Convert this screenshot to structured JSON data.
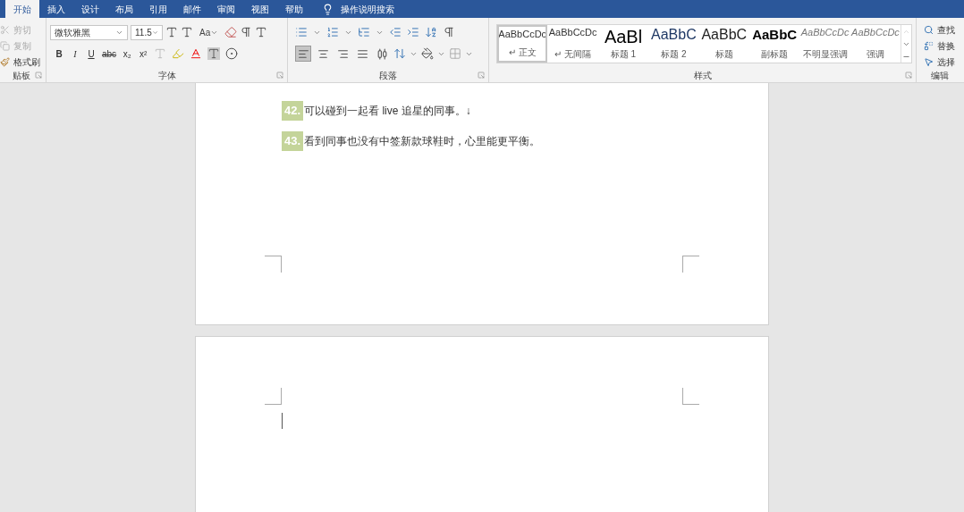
{
  "tabs": [
    {
      "label": "开始",
      "selected": true
    },
    {
      "label": "插入",
      "selected": false
    },
    {
      "label": "设计",
      "selected": false
    },
    {
      "label": "布局",
      "selected": false
    },
    {
      "label": "引用",
      "selected": false
    },
    {
      "label": "邮件",
      "selected": false
    },
    {
      "label": "审阅",
      "selected": false
    },
    {
      "label": "视图",
      "selected": false
    },
    {
      "label": "帮助",
      "selected": false
    }
  ],
  "tell_me": "操作说明搜索",
  "clipboard": {
    "group_label": "贴板",
    "items": [
      {
        "kind": "cut",
        "label": "剪切",
        "disabled": true
      },
      {
        "kind": "copy",
        "label": "复制",
        "disabled": true
      },
      {
        "kind": "painter",
        "label": "格式刷",
        "disabled": false
      }
    ]
  },
  "font": {
    "group_label": "字体",
    "font_name": "微软雅黑",
    "font_size": "11.5",
    "case_button": "Aa",
    "format_buttons": [
      {
        "kind": "bold",
        "text": "B"
      },
      {
        "kind": "italic",
        "text": "I"
      },
      {
        "kind": "underline",
        "text": "U"
      },
      {
        "kind": "strike",
        "text": "abc"
      },
      {
        "kind": "sub",
        "text": "x₂"
      },
      {
        "kind": "sup",
        "text": "x²"
      }
    ]
  },
  "paragraph": {
    "group_label": "段落",
    "alignments": [
      {
        "kind": "left",
        "selected": true
      },
      {
        "kind": "center",
        "selected": false
      },
      {
        "kind": "right",
        "selected": false
      },
      {
        "kind": "justify",
        "selected": false
      },
      {
        "kind": "distributed",
        "selected": false
      }
    ]
  },
  "styles": {
    "group_label": "样式",
    "items": [
      {
        "kind": "normal",
        "preview": "AaBbCcDc",
        "label": "↵ 正文",
        "selected": true
      },
      {
        "kind": "normal",
        "preview": "AaBbCcDc",
        "label": "↵ 无间隔",
        "selected": false
      },
      {
        "kind": "heading1",
        "preview": "AaBl",
        "label": "标题 1",
        "selected": false
      },
      {
        "kind": "heading2",
        "preview": "AaBbC",
        "label": "标题 2",
        "selected": false
      },
      {
        "kind": "title",
        "preview": "AaBbC",
        "label": "标题",
        "selected": false
      },
      {
        "kind": "subtitle",
        "preview": "AaBbC",
        "label": "副标题",
        "selected": false
      },
      {
        "kind": "subtle",
        "preview": "AaBbCcDc",
        "label": "不明显强调",
        "selected": false
      },
      {
        "kind": "subtle",
        "preview": "AaBbCcDc",
        "label": "强调",
        "selected": false
      }
    ]
  },
  "editing": {
    "group_label": "编辑",
    "items": [
      {
        "kind": "find",
        "label": "查找"
      },
      {
        "kind": "replace",
        "label": "替换"
      },
      {
        "kind": "select",
        "label": "选择"
      }
    ]
  },
  "document": {
    "items": [
      {
        "number": "42.",
        "text": "可以碰到一起看 live 追星的同事。↓"
      },
      {
        "number": "43.",
        "text": "看到同事也没有中签新款球鞋时，心里能更平衡。"
      }
    ]
  }
}
